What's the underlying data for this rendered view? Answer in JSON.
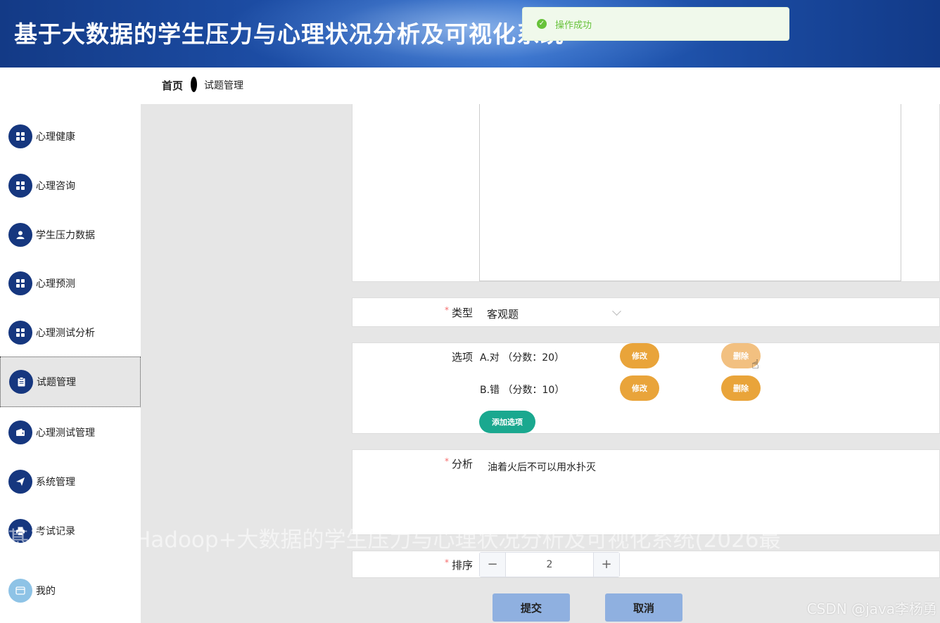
{
  "header": {
    "title": "基于大数据的学生压力与心理状况分析及可视化系统"
  },
  "toast": {
    "message": "操作成功",
    "icon": "check-circle-icon",
    "color": "#67c23a"
  },
  "breadcrumb": {
    "home": "首页",
    "current": "试题管理"
  },
  "sidebar": {
    "items": [
      {
        "label": "心理健康",
        "icon": "grid-icon"
      },
      {
        "label": "心理咨询",
        "icon": "grid-icon"
      },
      {
        "label": "学生压力数据",
        "icon": "user-icon"
      },
      {
        "label": "心理预测",
        "icon": "grid-icon"
      },
      {
        "label": "心理测试分析",
        "icon": "grid-icon"
      },
      {
        "label": "试题管理",
        "icon": "clipboard-icon",
        "active": true
      },
      {
        "label": "心理测试管理",
        "icon": "wallet-icon"
      },
      {
        "label": "系统管理",
        "icon": "send-icon"
      },
      {
        "label": "考试记录",
        "icon": "printer-icon"
      },
      {
        "label": "我的",
        "icon": "card-icon"
      }
    ]
  },
  "form": {
    "type_label": "类型",
    "type_value": "客观题",
    "options_label": "选项",
    "options": [
      {
        "text": "A.对 （分数：20）",
        "edit": "修改",
        "delete": "删除"
      },
      {
        "text": "B.错 （分数：10）",
        "edit": "修改",
        "delete": "删除"
      }
    ],
    "add_option": "添加选项",
    "analysis_label": "分析",
    "analysis_value": "油着火后不可以用水扑灭",
    "order_label": "排序",
    "order_value": "2",
    "submit": "提交",
    "cancel": "取消"
  },
  "overlay": {
    "caption_line1": "基于大数据+Hadoop+大数据的学生压力与心理状况分析及可视化系统(2026最",
    "caption_line2": "",
    "watermark": "CSDN @java李杨勇"
  },
  "colors": {
    "accent": "#16377f",
    "orange": "#e9a43a",
    "green": "#1aa88f",
    "button_blue": "#8fb0e0"
  }
}
